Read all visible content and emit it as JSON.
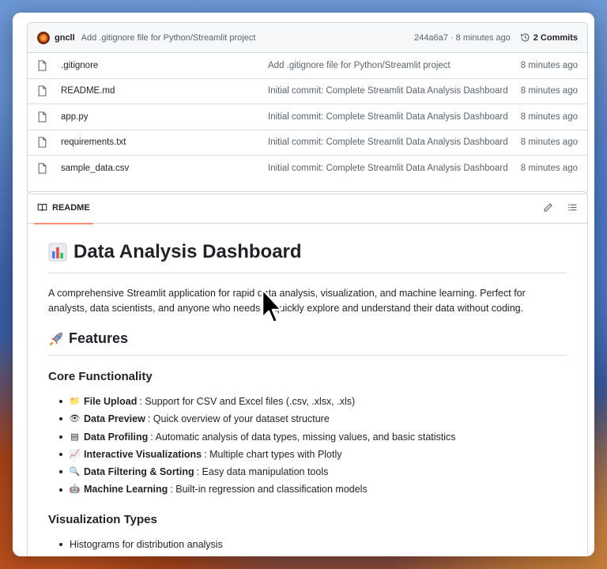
{
  "commit_bar": {
    "author": "gncll",
    "message": "Add .gitignore file for Python/Streamlit project",
    "hash_time": "244a6a7 · 8 minutes ago",
    "commits_label": "2 Commits"
  },
  "files": [
    {
      "name": ".gitignore",
      "commit": "Add .gitignore file for Python/Streamlit project",
      "time": "8 minutes ago"
    },
    {
      "name": "README.md",
      "commit": "Initial commit: Complete Streamlit Data Analysis Dashboard",
      "time": "8 minutes ago"
    },
    {
      "name": "app.py",
      "commit": "Initial commit: Complete Streamlit Data Analysis Dashboard",
      "time": "8 minutes ago"
    },
    {
      "name": "requirements.txt",
      "commit": "Initial commit: Complete Streamlit Data Analysis Dashboard",
      "time": "8 minutes ago"
    },
    {
      "name": "sample_data.csv",
      "commit": "Initial commit: Complete Streamlit Data Analysis Dashboard",
      "time": "8 minutes ago"
    }
  ],
  "readme": {
    "tab_label": "README",
    "title": "Data Analysis Dashboard",
    "intro": "A comprehensive Streamlit application for rapid data analysis, visualization, and machine learning. Perfect for analysts, data scientists, and anyone who needs to quickly explore and understand their data without coding.",
    "features_heading": "Features",
    "core_heading": "Core Functionality",
    "core_items": [
      {
        "emoji": "📁",
        "label": "File Upload",
        "text": ": Support for CSV and Excel files (.csv, .xlsx, .xls)"
      },
      {
        "emoji": "👁",
        "label": "Data Preview",
        "text": ": Quick overview of your dataset structure"
      },
      {
        "emoji": "▤",
        "label": "Data Profiling",
        "text": ": Automatic analysis of data types, missing values, and basic statistics"
      },
      {
        "emoji": "📈",
        "label": "Interactive Visualizations",
        "text": ": Multiple chart types with Plotly"
      },
      {
        "emoji": "🔍",
        "label": "Data Filtering & Sorting",
        "text": ": Easy data manipulation tools"
      },
      {
        "emoji": "🤖",
        "label": "Machine Learning",
        "text": ": Built-in regression and classification models"
      }
    ],
    "viz_heading": "Visualization Types",
    "viz_items": [
      "Histograms for distribution analysis"
    ]
  }
}
